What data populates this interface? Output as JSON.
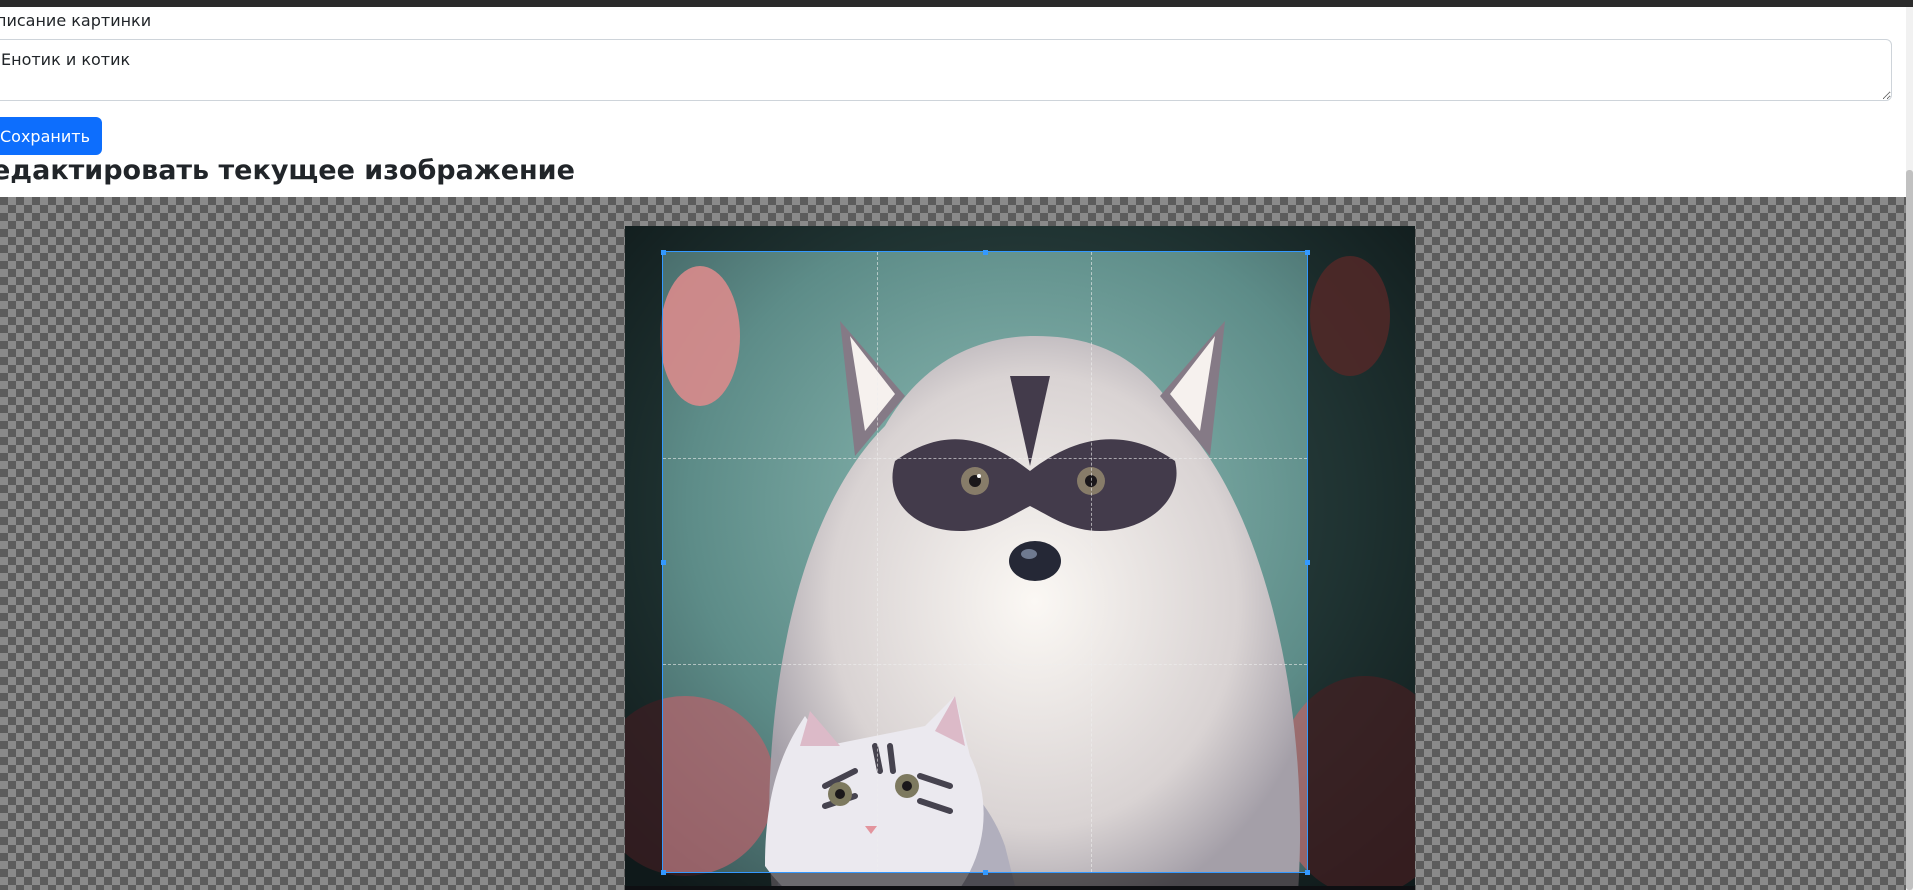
{
  "form": {
    "description_label": "писание картинки",
    "description_value": "Енотик и котик",
    "save_label": "Сохранить"
  },
  "editor": {
    "title": "едактировать текущее изображение",
    "accent_color": "#3399ff"
  },
  "colors": {
    "primary_button": "#0d6efd",
    "crop_outline": "#3399ff"
  }
}
